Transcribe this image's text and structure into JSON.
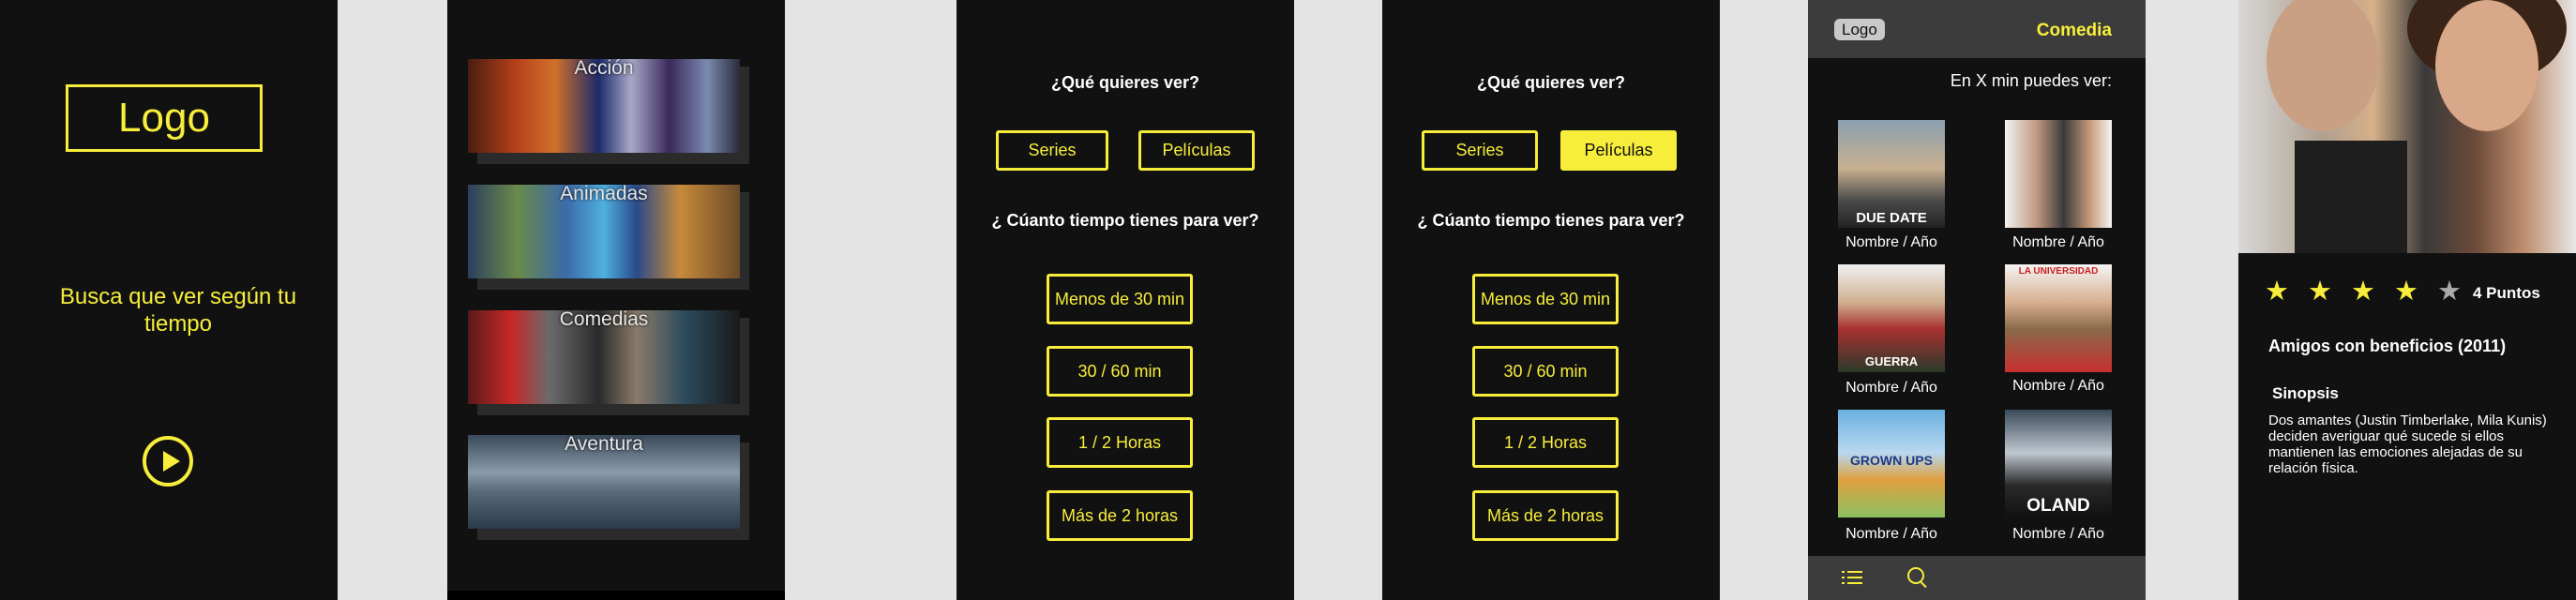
{
  "splash": {
    "logo": "Logo",
    "tagline": "Busca que ver según tu tiempo"
  },
  "genres": {
    "items": [
      {
        "label": "Acción"
      },
      {
        "label": "Animadas"
      },
      {
        "label": "Comedias"
      },
      {
        "label": "Aventura"
      }
    ]
  },
  "quiz": {
    "q1": "¿Qué quieres ver?",
    "opt_series": "Series",
    "opt_movies": "Películas",
    "q2": "¿ Cúanto tiempo tienes para ver?",
    "time_options": [
      "Menos de 30 min",
      "30 / 60 min",
      "1 / 2 Horas",
      "Más de 2 horas"
    ]
  },
  "results": {
    "logo": "Logo",
    "category": "Comedia",
    "subtitle": "En X min puedes ver:",
    "poster_label": "Nombre / Año",
    "posters": [
      {
        "text": "DUE DATE"
      },
      {
        "text": ""
      },
      {
        "text": "GUERRA"
      },
      {
        "text": "LA UNIVERSIDAD"
      },
      {
        "text": "GROWN UPS"
      },
      {
        "text": "OLAND"
      }
    ]
  },
  "detail": {
    "rating_stars": 4,
    "max_stars": 5,
    "points": "4 Puntos",
    "title": "Amigos con beneficios (2011)",
    "synopsis_heading": "Sinopsis",
    "synopsis": "Dos amantes (Justin Timberlake, Mila Kunis) deciden averiguar qué sucede si ellos mantienen las emociones alejadas de su relación física."
  },
  "colors": {
    "accent": "#f7ee3b",
    "background": "#111111",
    "bar": "#3c3c3c",
    "gutter": "#e4e4e4"
  }
}
